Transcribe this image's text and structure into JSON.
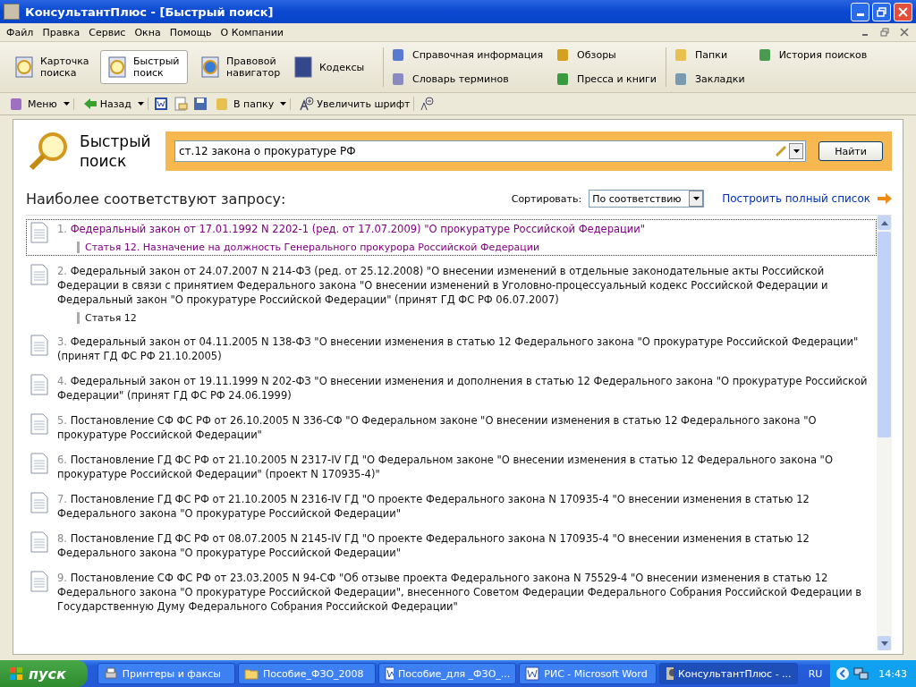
{
  "window": {
    "title": "КонсультантПлюс - [Быстрый поиск]"
  },
  "menu": [
    "Файл",
    "Правка",
    "Сервис",
    "Окна",
    "Помощь",
    "О Компании"
  ],
  "main_toolbar": [
    {
      "label": "Карточка поиска",
      "selected": false
    },
    {
      "label": "Быстрый поиск",
      "selected": true
    },
    {
      "label": "Правовой навигатор",
      "selected": false
    },
    {
      "label": "Кодексы",
      "selected": false
    }
  ],
  "info_links": [
    "Справочная информация",
    "Обзоры",
    "Словарь терминов",
    "Пресса и книги"
  ],
  "user_links": [
    "Папки",
    "История поисков",
    "Закладки"
  ],
  "small_toolbar": {
    "menu": "Меню",
    "back": "Назад",
    "folder": "В папку",
    "font": "Увеличить шрифт"
  },
  "search": {
    "title": "Быстрый поиск",
    "value": "ст.12 закона о прокуратуре РФ",
    "button": "Найти"
  },
  "results_header": "Наиболее соответствуют запросу:",
  "sort": {
    "label": "Сортировать:",
    "value": "По соответствию"
  },
  "full_list_link": "Построить полный список",
  "results": [
    {
      "number": "1.",
      "title": "Федеральный закон от 17.01.1992 N 2202-1 (ред. от 17.07.2009) \"О прокуратуре Российской Федерации\"",
      "article": "Статья 12. Назначение на должность Генерального прокурора Российской Федерации",
      "visited": true,
      "selected": true
    },
    {
      "number": "2.",
      "title": "Федеральный закон от 24.07.2007 N 214-ФЗ (ред. от 25.12.2008) \"О внесении изменений в отдельные законодательные акты Российской Федерации в связи с принятием Федерального закона \"О внесении изменений в Уголовно-процессуальный кодекс Российской Федерации и Федеральный закон \"О прокуратуре Российской Федерации\" (принят ГД ФС РФ 06.07.2007)",
      "article": "Статья 12",
      "visited": false,
      "selected": false
    },
    {
      "number": "3.",
      "title": "Федеральный закон от 04.11.2005 N 138-ФЗ \"О внесении изменения в статью 12 Федерального закона \"О прокуратуре Российской Федерации\" (принят ГД ФС РФ 21.10.2005)",
      "visited": false,
      "selected": false
    },
    {
      "number": "4.",
      "title": "Федеральный закон от 19.11.1999 N 202-ФЗ \"О внесении изменения и дополнения в статью 12 Федерального закона \"О прокуратуре Российской Федерации\" (принят ГД ФС РФ 24.06.1999)",
      "visited": false,
      "selected": false
    },
    {
      "number": "5.",
      "title": "Постановление СФ ФС РФ от 26.10.2005 N 336-СФ \"О Федеральном законе \"О внесении изменения в статью 12 Федерального закона \"О прокуратуре Российской Федерации\"",
      "visited": false,
      "selected": false
    },
    {
      "number": "6.",
      "title": "Постановление ГД ФС РФ от 21.10.2005 N 2317-IV ГД \"О Федеральном законе \"О внесении изменения в статью 12 Федерального закона \"О прокуратуре Российской Федерации\" (проект N 170935-4)\"",
      "visited": false,
      "selected": false
    },
    {
      "number": "7.",
      "title": "Постановление ГД ФС РФ от 21.10.2005 N 2316-IV ГД \"О проекте Федерального закона N 170935-4 \"О внесении изменения в статью 12 Федерального закона \"О прокуратуре Российской Федерации\"",
      "visited": false,
      "selected": false
    },
    {
      "number": "8.",
      "title": "Постановление ГД ФС РФ от 08.07.2005 N 2145-IV ГД \"О проекте Федерального закона N 170935-4 \"О внесении изменения в статью 12 Федерального закона \"О прокуратуре Российской Федерации\"",
      "visited": false,
      "selected": false
    },
    {
      "number": "9.",
      "title": "Постановление СФ ФС РФ от 23.03.2005 N 94-СФ \"Об отзыве проекта Федерального закона N 75529-4 \"О внесении изменения в статью 12 Федерального закона \"О прокуратуре Российской Федерации\", внесенного Советом Федерации Федерального Собрания Российской Федерации в Государственную Думу Федерального Собрания Российской Федерации\"",
      "visited": false,
      "selected": false
    }
  ],
  "taskbar": {
    "start": "пуск",
    "tasks": [
      {
        "label": "Принтеры и факсы",
        "kind": "printer",
        "selected": false
      },
      {
        "label": "Пособие_ФЗО_2008",
        "kind": "folder",
        "selected": false
      },
      {
        "label": "Пособие_для _ФЗО_...",
        "kind": "word",
        "selected": false
      },
      {
        "label": "РИС - Microsoft Word",
        "kind": "word",
        "selected": false
      },
      {
        "label": "КонсультантПлюс - ...",
        "kind": "app",
        "selected": true
      }
    ],
    "language": "RU",
    "time": "14:43"
  }
}
